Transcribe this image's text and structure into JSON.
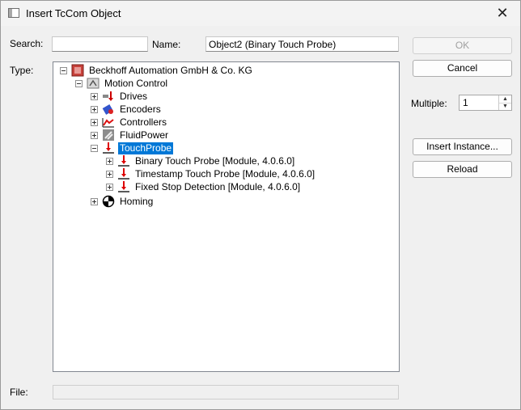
{
  "window": {
    "title": "Insert TcCom Object"
  },
  "search": {
    "label": "Search:",
    "value": ""
  },
  "name": {
    "label": "Name:",
    "value": "Object2 (Binary Touch Probe)"
  },
  "type": {
    "label": "Type:"
  },
  "file": {
    "label": "File:",
    "value": ""
  },
  "buttons": {
    "ok": "OK",
    "cancel": "Cancel",
    "insert_instance": "Insert Instance...",
    "reload": "Reload"
  },
  "multiple": {
    "label": "Multiple:",
    "value": "1"
  },
  "tree": {
    "root": "Beckhoff Automation GmbH & Co. KG",
    "motion_control": "Motion Control",
    "drives": "Drives",
    "encoders": "Encoders",
    "controllers": "Controllers",
    "fluidpower": "FluidPower",
    "touchprobe": "TouchProbe",
    "binary": "Binary Touch Probe [Module, 4.0.6.0]",
    "timestamp": "Timestamp Touch Probe [Module, 4.0.6.0]",
    "fixedstop": "Fixed Stop Detection [Module, 4.0.6.0]",
    "homing": "Homing"
  }
}
